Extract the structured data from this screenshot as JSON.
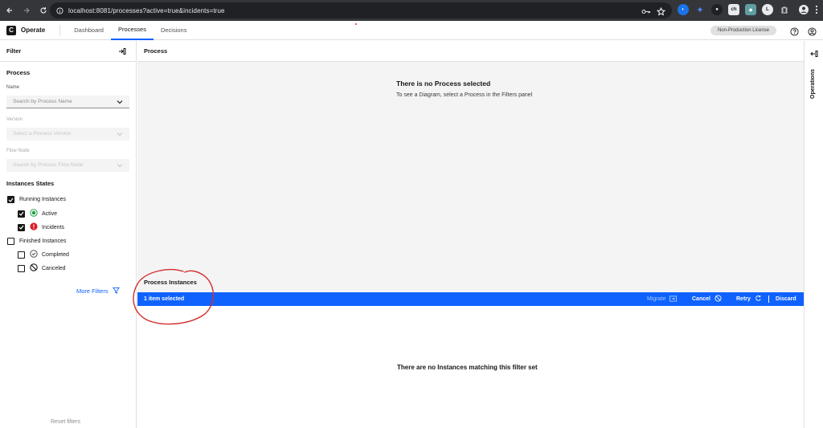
{
  "browser": {
    "url": "localhost:8081/processes?active=true&incidents=true"
  },
  "app": {
    "name": "Operate",
    "logo_letter": "C",
    "nav": [
      {
        "label": "Dashboard"
      },
      {
        "label": "Processes",
        "active": true
      },
      {
        "label": "Decisions"
      }
    ],
    "license": "Non-Production License"
  },
  "filters": {
    "title": "Filter",
    "process_section": "Process",
    "name_label": "Name",
    "name_placeholder": "Search by Process Name",
    "version_label": "Version",
    "version_placeholder": "Select a Process Version",
    "flow_node_label": "Flow Node",
    "flow_node_placeholder": "Search by Process Flow Node",
    "states_section": "Instances States",
    "running": {
      "label": "Running Instances",
      "checked": true
    },
    "active": {
      "label": "Active",
      "checked": true
    },
    "incidents": {
      "label": "Incidents",
      "checked": true
    },
    "finished": {
      "label": "Finished Instances",
      "checked": false
    },
    "completed": {
      "label": "Completed",
      "checked": false
    },
    "canceled": {
      "label": "Canceled",
      "checked": false
    },
    "more_filters": "More Filters",
    "reset": "Reset filters"
  },
  "process": {
    "title": "Process",
    "empty_title": "There is no Process selected",
    "empty_subtitle": "To see a Diagram, select a Process in the Filters panel"
  },
  "instances": {
    "title": "Process Instances",
    "selected": "1 item selected",
    "migrate": "Migrate",
    "cancel": "Cancel",
    "retry": "Retry",
    "discard": "Discard",
    "empty": "There are no Instances matching this filter set"
  },
  "operations": {
    "label": "Operations"
  },
  "colors": {
    "primary": "#0f62fe",
    "annotation": "#d32f2f",
    "active": "#24a148",
    "incident": "#da1e28"
  }
}
